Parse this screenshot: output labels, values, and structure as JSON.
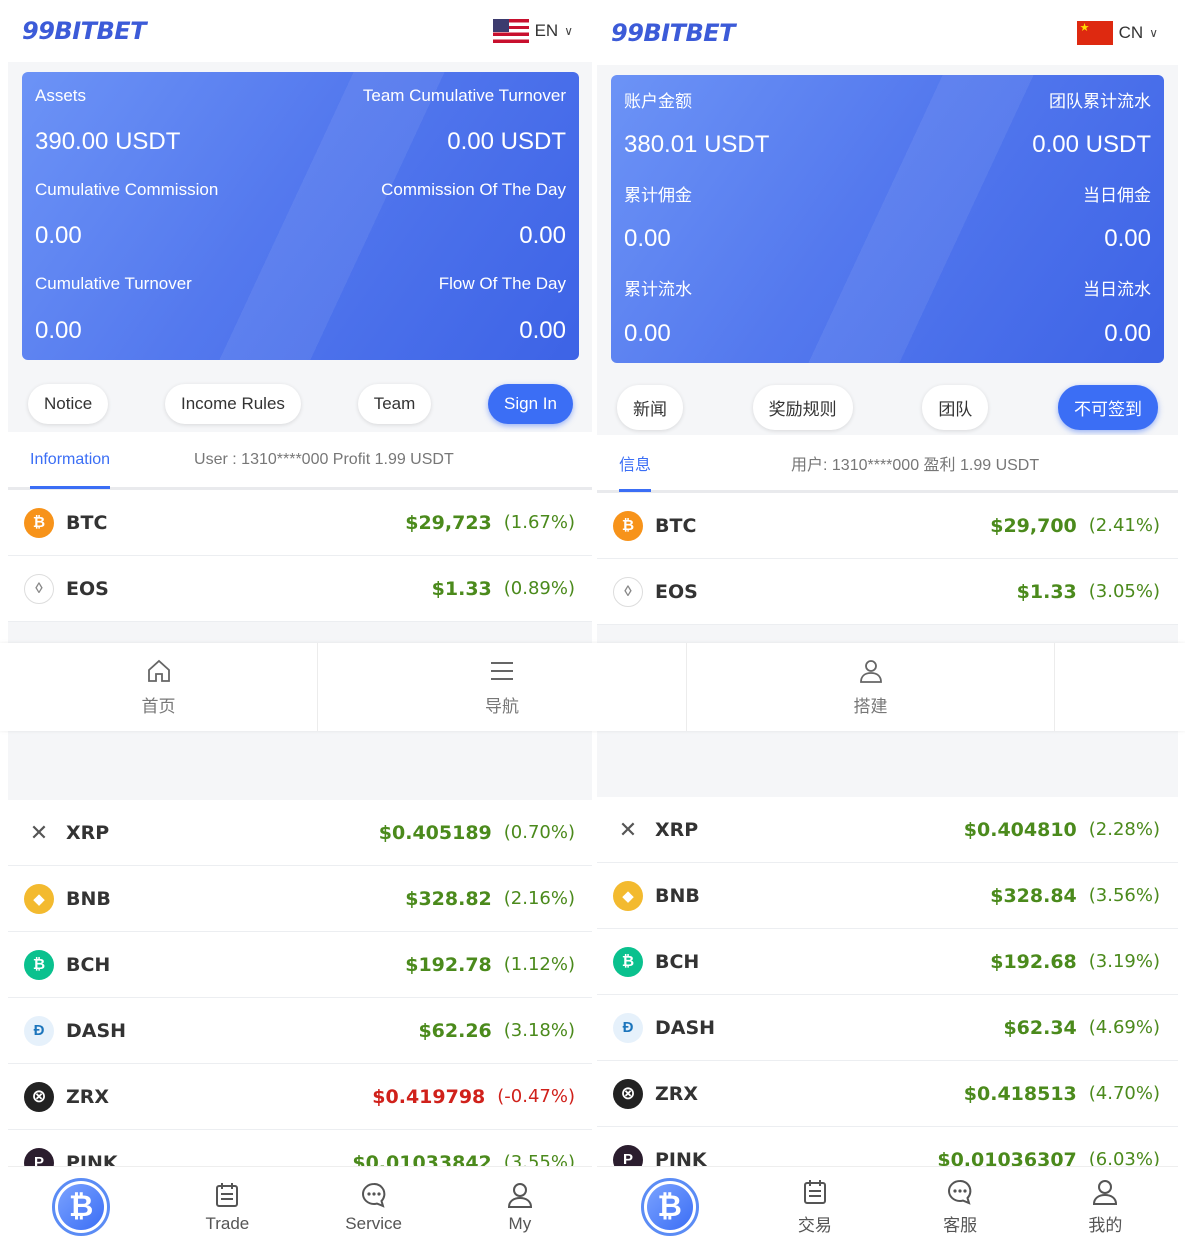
{
  "left": {
    "logo": "99BITBET",
    "lang": "EN",
    "card": {
      "assets_label": "Assets",
      "assets_value": "390.00 USDT",
      "team_label": "Team Cumulative Turnover",
      "team_value": "0.00 USDT",
      "cumcomm_label": "Cumulative Commission",
      "cumcomm_value": "0.00",
      "daycomm_label": "Commission Of The Day",
      "daycomm_value": "0.00",
      "cumturn_label": "Cumulative Turnover",
      "cumturn_value": "0.00",
      "flow_label": "Flow Of The Day",
      "flow_value": "0.00"
    },
    "buttons": {
      "notice": "Notice",
      "income": "Income Rules",
      "team": "Team",
      "signin": "Sign In"
    },
    "info_tab": "Information",
    "user_line": "User : 1310****000 Profit 1.99 USDT",
    "coins_top": [
      {
        "name": "BTC",
        "price": "$29,723",
        "pct": "(1.67%)"
      },
      {
        "name": "EOS",
        "price": "$1.33",
        "pct": "(0.89%)"
      }
    ],
    "coins_bottom": [
      {
        "name": "XRP",
        "price": "$0.405189",
        "pct": "(0.70%)"
      },
      {
        "name": "BNB",
        "price": "$328.82",
        "pct": "(2.16%)"
      },
      {
        "name": "BCH",
        "price": "$192.78",
        "pct": "(1.12%)"
      },
      {
        "name": "DASH",
        "price": "$62.26",
        "pct": "(3.18%)"
      },
      {
        "name": "ZRX",
        "price": "$0.419798",
        "pct": "(-0.47%)"
      },
      {
        "name": "PINK",
        "price": "$0.01033842",
        "pct": "(3.55%)"
      }
    ],
    "tabs": {
      "trade": "Trade",
      "service": "Service",
      "my": "My"
    }
  },
  "right": {
    "logo": "99BITBET",
    "lang": "CN",
    "card": {
      "assets_label": "账户金额",
      "assets_value": "380.01 USDT",
      "team_label": "团队累计流水",
      "team_value": "0.00 USDT",
      "cumcomm_label": "累计佣金",
      "cumcomm_value": "0.00",
      "daycomm_label": "当日佣金",
      "daycomm_value": "0.00",
      "cumturn_label": "累计流水",
      "cumturn_value": "0.00",
      "flow_label": "当日流水",
      "flow_value": "0.00"
    },
    "buttons": {
      "notice": "新闻",
      "income": "奖励规则",
      "team": "团队",
      "signin": "不可签到"
    },
    "info_tab": "信息",
    "user_line": "用户: 1310****000 盈利 1.99 USDT",
    "coins_top": [
      {
        "name": "BTC",
        "price": "$29,700",
        "pct": "(2.41%)"
      },
      {
        "name": "EOS",
        "price": "$1.33",
        "pct": "(3.05%)"
      }
    ],
    "coins_bottom": [
      {
        "name": "XRP",
        "price": "$0.404810",
        "pct": "(2.28%)"
      },
      {
        "name": "BNB",
        "price": "$328.84",
        "pct": "(3.56%)"
      },
      {
        "name": "BCH",
        "price": "$192.68",
        "pct": "(3.19%)"
      },
      {
        "name": "DASH",
        "price": "$62.34",
        "pct": "(4.69%)"
      },
      {
        "name": "ZRX",
        "price": "$0.418513",
        "pct": "(4.70%)"
      },
      {
        "name": "PINK",
        "price": "$0.01036307",
        "pct": "(6.03%)"
      }
    ],
    "tabs": {
      "trade": "交易",
      "service": "客服",
      "my": "我的"
    }
  },
  "overlay_nav": {
    "home": "首页",
    "nav": "导航",
    "build": "搭建"
  },
  "colors": {
    "accent": "#3b6ef5",
    "up": "#4b8a1c",
    "down": "#d0211b"
  },
  "icons": {
    "btc": "bitcoin-icon",
    "eos": "eos-icon",
    "xrp": "xrp-icon",
    "bnb": "bnb-icon",
    "bch": "bch-icon",
    "dash": "dash-icon",
    "zrx": "zrx-icon",
    "pink": "pink-icon"
  }
}
